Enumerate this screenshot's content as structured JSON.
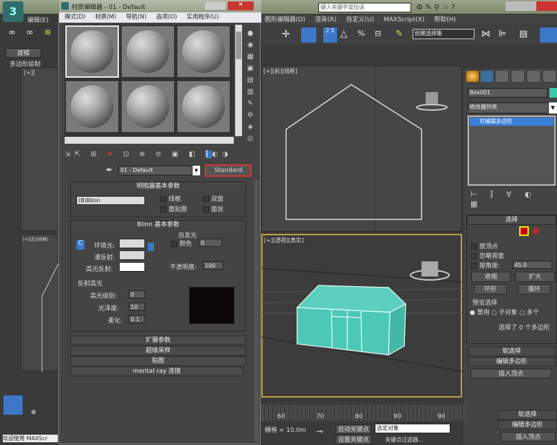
{
  "app": {
    "search_placeholder": "键入关键字或短语",
    "menu": [
      "图形编辑器(D)",
      "渲染(R)",
      "自定义(U)",
      "MAXScript(X)",
      "帮助(H)"
    ],
    "left_menu": "编辑(E)",
    "selection_set": "创建选择集",
    "left_tab": "建模",
    "left_tab2": "多边形绘制"
  },
  "material_editor": {
    "title": "材质编辑器 - 01 - Default",
    "menu": [
      "模式(D)",
      "材质(M)",
      "导航(N)",
      "选项(O)",
      "实用程序(U)"
    ],
    "material_name": "01 - Default",
    "material_type": "Standard",
    "shader_rollout": {
      "title": "明暗器基本参数",
      "shader": "(B)Blinn",
      "options": [
        "线框",
        "双面",
        "面贴图",
        "面状"
      ]
    },
    "blinn_rollout": {
      "title": "Blinn 基本参数",
      "ambient": "环境光:",
      "diffuse": "漫反射:",
      "specular": "高光反射:",
      "self_illum_title": "自发光",
      "color_label": "颜色",
      "self_illum_value": "0",
      "opacity_label": "不透明度:",
      "opacity_value": "100",
      "spec_title": "反射高光",
      "spec_level_label": "高光级别:",
      "spec_level": "0",
      "gloss_label": "光泽度:",
      "gloss": "10",
      "soften_label": "柔化:",
      "soften": "0.1",
      "lock": "C"
    },
    "collapsed_rollouts": [
      "扩展参数",
      "超级采样",
      "贴图",
      "mental ray 连接"
    ]
  },
  "viewports": {
    "top_label": "[+][前][线框]",
    "left_label": "[+][左][线框]",
    "persp_label": "[+][透视][真实]"
  },
  "command_panel": {
    "object_name": "Box001",
    "object_color": "#3cc8a8",
    "modifier_list": "修改器列表",
    "stack_item": "可编辑多边形",
    "selection": {
      "title": "选择",
      "by_vertex": "按顶点",
      "ignore_backfacing": "忽略背面",
      "by_angle": "按角度:",
      "angle": "45.0",
      "shrink": "收缩",
      "grow": "扩大",
      "ring": "环形",
      "loop": "循环",
      "preview_title": "预览选择",
      "preview_options": [
        "禁用",
        "子对象",
        "多个"
      ],
      "status": "选择了 0 个多边形"
    },
    "soft_selection": "软选择",
    "edit_polygons": "编辑多边形",
    "insert_vertex": "插入顶点"
  },
  "timeline": {
    "ticks": [
      "60",
      "70",
      "80",
      "90",
      "90"
    ]
  },
  "status": {
    "welcome": "欢迎使用 MAXScr",
    "grid": "栅格 = 10.0m",
    "auto_key": "自动关键点",
    "set_key": "设置关键点",
    "selected": "选定对象",
    "key_filter": "关键点过滤器..."
  }
}
